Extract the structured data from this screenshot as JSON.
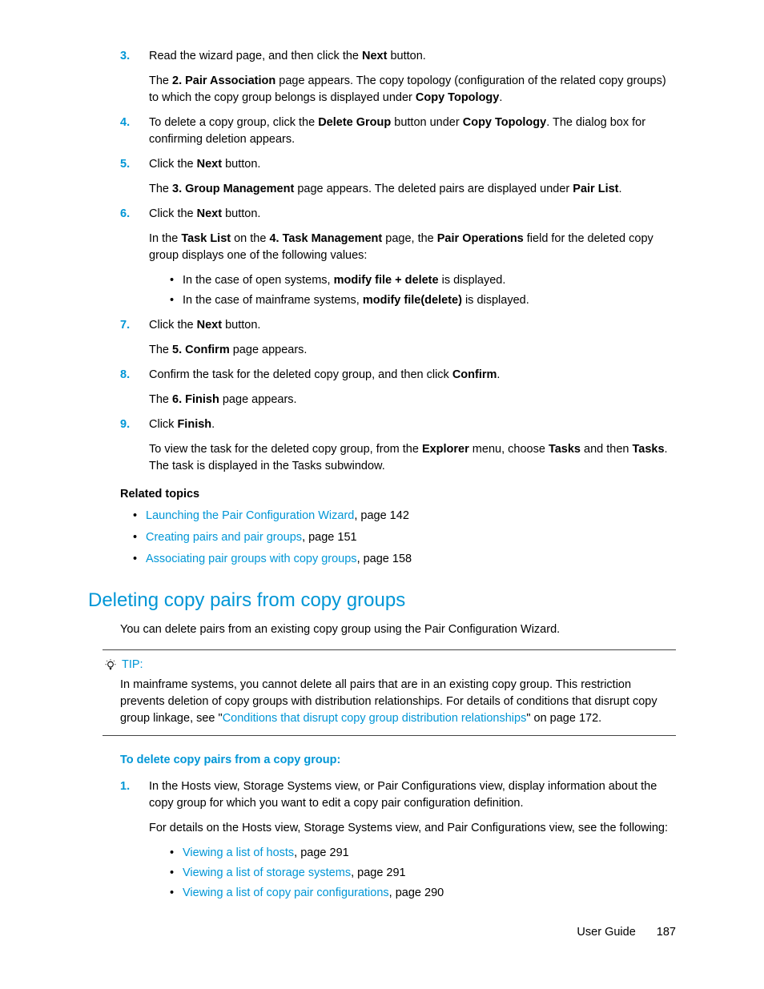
{
  "steps_a": [
    {
      "num": "3.",
      "runs": [
        {
          "t": "Read the wizard page, and then click the "
        },
        {
          "t": "Next",
          "b": true
        },
        {
          "t": " button."
        }
      ],
      "after": [
        [
          {
            "t": "The "
          },
          {
            "t": "2. Pair Association",
            "b": true
          },
          {
            "t": " page appears. The copy topology (configuration of the related copy groups) to which the copy group belongs is displayed under "
          },
          {
            "t": "Copy Topology",
            "b": true
          },
          {
            "t": "."
          }
        ]
      ]
    },
    {
      "num": "4.",
      "runs": [
        {
          "t": "To delete a copy group, click the "
        },
        {
          "t": "Delete Group",
          "b": true
        },
        {
          "t": " button under "
        },
        {
          "t": "Copy Topology",
          "b": true
        },
        {
          "t": ". The dialog box for confirming deletion appears."
        }
      ]
    },
    {
      "num": "5.",
      "runs": [
        {
          "t": "Click the "
        },
        {
          "t": "Next",
          "b": true
        },
        {
          "t": " button."
        }
      ],
      "after": [
        [
          {
            "t": "The "
          },
          {
            "t": "3. Group Management",
            "b": true
          },
          {
            "t": " page appears. The deleted pairs are displayed under "
          },
          {
            "t": "Pair List",
            "b": true
          },
          {
            "t": "."
          }
        ]
      ]
    },
    {
      "num": "6.",
      "runs": [
        {
          "t": "Click the "
        },
        {
          "t": "Next",
          "b": true
        },
        {
          "t": " button."
        }
      ],
      "after": [
        [
          {
            "t": "In the "
          },
          {
            "t": "Task List",
            "b": true
          },
          {
            "t": "  on the "
          },
          {
            "t": "4. Task Management",
            "b": true
          },
          {
            "t": " page, the "
          },
          {
            "t": "Pair Operations",
            "b": true
          },
          {
            "t": " field for the deleted copy group displays one of the following values:"
          }
        ]
      ],
      "bullets": [
        [
          {
            "t": "In the case of open systems, "
          },
          {
            "t": "modify file + delete",
            "b": true
          },
          {
            "t": " is displayed."
          }
        ],
        [
          {
            "t": "In the case of mainframe systems, "
          },
          {
            "t": "modify file(delete)",
            "b": true
          },
          {
            "t": " is displayed."
          }
        ]
      ]
    },
    {
      "num": "7.",
      "runs": [
        {
          "t": "Click the "
        },
        {
          "t": "Next",
          "b": true
        },
        {
          "t": " button."
        }
      ],
      "after": [
        [
          {
            "t": "The "
          },
          {
            "t": "5. Confirm",
            "b": true
          },
          {
            "t": " page appears."
          }
        ]
      ]
    },
    {
      "num": "8.",
      "runs": [
        {
          "t": "Confirm the task for the deleted copy group, and then click "
        },
        {
          "t": "Confirm",
          "b": true
        },
        {
          "t": "."
        }
      ],
      "after": [
        [
          {
            "t": "The "
          },
          {
            "t": "6. Finish",
            "b": true
          },
          {
            "t": " page appears."
          }
        ]
      ]
    },
    {
      "num": "9.",
      "runs": [
        {
          "t": "Click "
        },
        {
          "t": "Finish",
          "b": true
        },
        {
          "t": "."
        }
      ],
      "after": [
        [
          {
            "t": "To view the task for the deleted copy group, from the "
          },
          {
            "t": "Explorer",
            "b": true
          },
          {
            "t": " menu, choose "
          },
          {
            "t": "Tasks",
            "b": true
          },
          {
            "t": " and then "
          },
          {
            "t": "Tasks",
            "b": true
          },
          {
            "t": ". The task is displayed in the Tasks subwindow."
          }
        ]
      ]
    }
  ],
  "related_heading": "Related topics",
  "related": [
    {
      "link": "Launching the Pair Configuration Wizard",
      "suffix": ", page 142"
    },
    {
      "link": "Creating pairs and pair groups",
      "suffix": ", page 151"
    },
    {
      "link": "Associating pair groups with copy groups",
      "suffix": ", page 158"
    }
  ],
  "section_heading": "Deleting copy pairs from copy groups",
  "section_intro": "You can delete pairs from an existing copy group using the Pair Configuration Wizard.",
  "tip_label": "TIP:",
  "tip_runs": [
    {
      "t": "In mainframe systems, you cannot delete all pairs that are in an existing copy group. This restriction prevents deletion of copy groups with distribution relationships. For details of conditions that disrupt copy group linkage, see \""
    },
    {
      "t": "Conditions that disrupt copy group distribution relationships",
      "link": true
    },
    {
      "t": "\" on page 172."
    }
  ],
  "proc_heading": "To delete copy pairs from a copy group:",
  "steps_b": [
    {
      "num": "1.",
      "runs": [
        {
          "t": "In the Hosts view, Storage Systems view, or Pair Configurations view, display information about the copy group for which you want to edit a copy pair configuration definition."
        }
      ],
      "after": [
        [
          {
            "t": "For details on the Hosts view, Storage Systems view, and Pair Configurations view, see the following:"
          }
        ]
      ],
      "link_bullets": [
        {
          "link": "Viewing a list of hosts",
          "suffix": ", page 291"
        },
        {
          "link": "Viewing a list of storage systems",
          "suffix": ", page 291"
        },
        {
          "link": "Viewing a list of copy pair configurations",
          "suffix": ", page 290"
        }
      ]
    }
  ],
  "footer_label": "User Guide",
  "footer_page": "187"
}
